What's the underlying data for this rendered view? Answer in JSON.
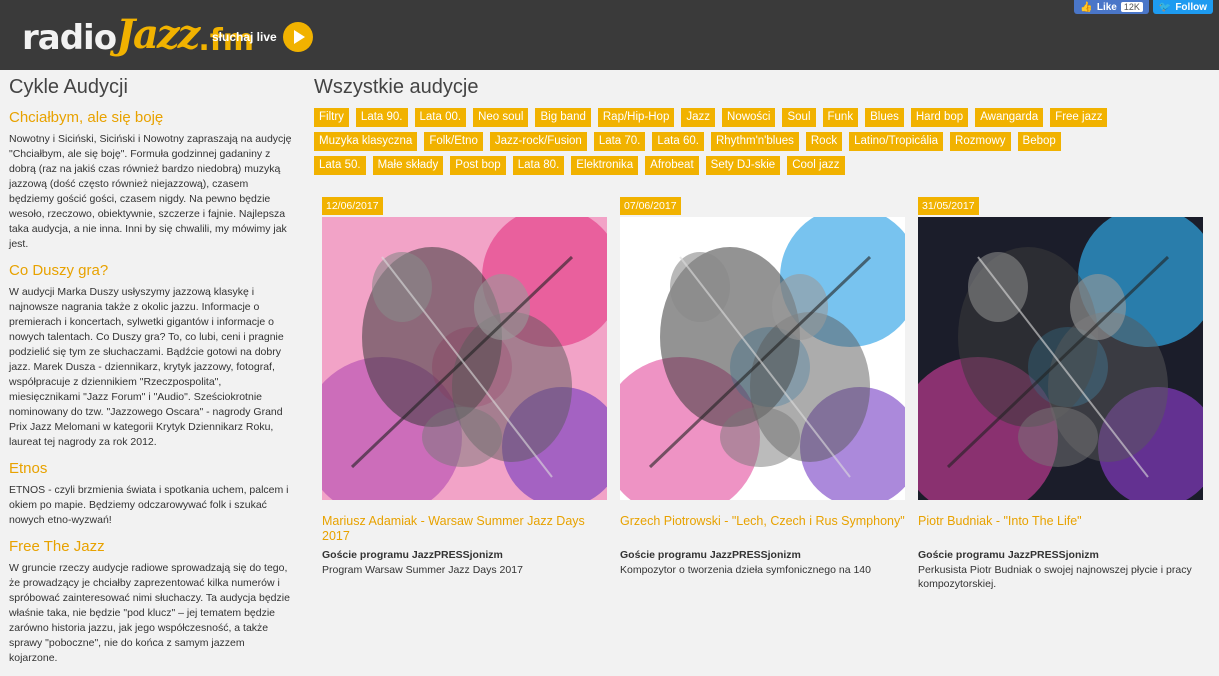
{
  "header": {
    "logo_radio": "radio",
    "logo_jazz": "Jazz",
    "logo_fm": ".fm",
    "live_label": "słuchaj live",
    "like_label": "Like",
    "like_count": "12K",
    "follow_label": "Follow"
  },
  "left": {
    "title": "Cykle Audycji",
    "cycles": [
      {
        "title": "Chciałbym, ale się boję",
        "text": "Nowotny i Siciński, Siciński i Nowotny zapraszają na audycję \"Chciałbym, ale się boję\". Formuła godzinnej gadaniny z dobrą (raz na jakiś czas również bardzo niedobrą) muzyką jazzową (dość często również niejazzową), czasem będziemy gościć gości, czasem nigdy. Na pewno będzie wesoło, rzeczowo, obiektywnie, szczerze i fajnie. Najlepsza taka audycja, a nie inna. Inni by się chwalili, my mówimy jak jest."
      },
      {
        "title": "Co Duszy gra?",
        "text": "W audycji Marka Duszy usłyszymy jazzową klasykę i najnowsze nagrania także z okolic jazzu. Informacje o premierach i koncertach, sylwetki gigantów i informacje o nowych talentach. Co Duszy gra? To, co lubi, ceni i pragnie podzielić się tym ze słuchaczami. Bądźcie gotowi na dobry jazz. Marek Dusza - dziennikarz, krytyk jazzowy, fotograf, współpracuje z dziennikiem \"Rzeczpospolita\", miesięcznikami \"Jazz Forum\" i \"Audio\". Sześciokrotnie nominowany do tzw. \"Jazzowego Oscara\" - nagrody Grand Prix Jazz Melomani w kategorii Krytyk Dziennikarz Roku, laureat tej nagrody za rok 2012."
      },
      {
        "title": "Etnos",
        "text": "ETNOS - czyli brzmienia świata i spotkania uchem, palcem i okiem po mapie. Będziemy odczarowywać folk i szukać nowych etno-wyzwań!"
      },
      {
        "title": "Free The Jazz",
        "text": "W gruncie rzeczy audycje radiowe sprowadzają się do tego, że prowadzący je chciałby zaprezentować kilka numerów i spróbować zainteresować nimi słuchaczy. Ta audycja będzie właśnie taka, nie będzie \"pod klucz\" – jej tematem będzie zarówno historia jazzu, jak jego współczesność, a także sprawy \"poboczne\", nie do końca z samym jazzem kojarzone."
      }
    ]
  },
  "main": {
    "title": "Wszystkie audycje",
    "tags": [
      "Filtry",
      "Lata 90.",
      "Lata 00.",
      "Neo soul",
      "Big band",
      "Rap/Hip-Hop",
      "Jazz",
      "Nowości",
      "Soul",
      "Funk",
      "Blues",
      "Hard bop",
      "Awangarda",
      "Free jazz",
      "Muzyka klasyczna",
      "Folk/Etno",
      "Jazz-rock/Fusion",
      "Lata 70.",
      "Lata 60.",
      "Rhythm'n'blues",
      "Rock",
      "Latino/Tropicália",
      "Rozmowy",
      "Bebop",
      "Lata 50.",
      "Małe składy",
      "Post bop",
      "Lata 80.",
      "Elektronika",
      "Afrobeat",
      "Sety DJ-skie",
      "Cool jazz"
    ],
    "cards": [
      {
        "date": "12/06/2017",
        "title": "Mariusz Adamiak - Warsaw Summer Jazz Days 2017",
        "guest": "Goście programu JazzPRESSjonizm",
        "desc": "Program Warsaw Summer Jazz Days 2017"
      },
      {
        "date": "07/06/2017",
        "title": "Grzech Piotrowski - \"Lech, Czech i Rus Symphony\"",
        "guest": "Goście programu JazzPRESSjonizm",
        "desc": "Kompozytor o tworzenia dzieła symfonicznego na 140"
      },
      {
        "date": "31/05/2017",
        "title": "Piotr Budniak - \"Into The Life\"",
        "guest": "Goście programu JazzPRESSjonizm",
        "desc": "Perkusista Piotr Budniak o swojej najnowszej płycie i pracy kompozytorskiej."
      }
    ]
  },
  "colors": {
    "accent": "#f1b200",
    "header_bg": "#3a3a3a",
    "page_bg": "#f2f2f2"
  }
}
